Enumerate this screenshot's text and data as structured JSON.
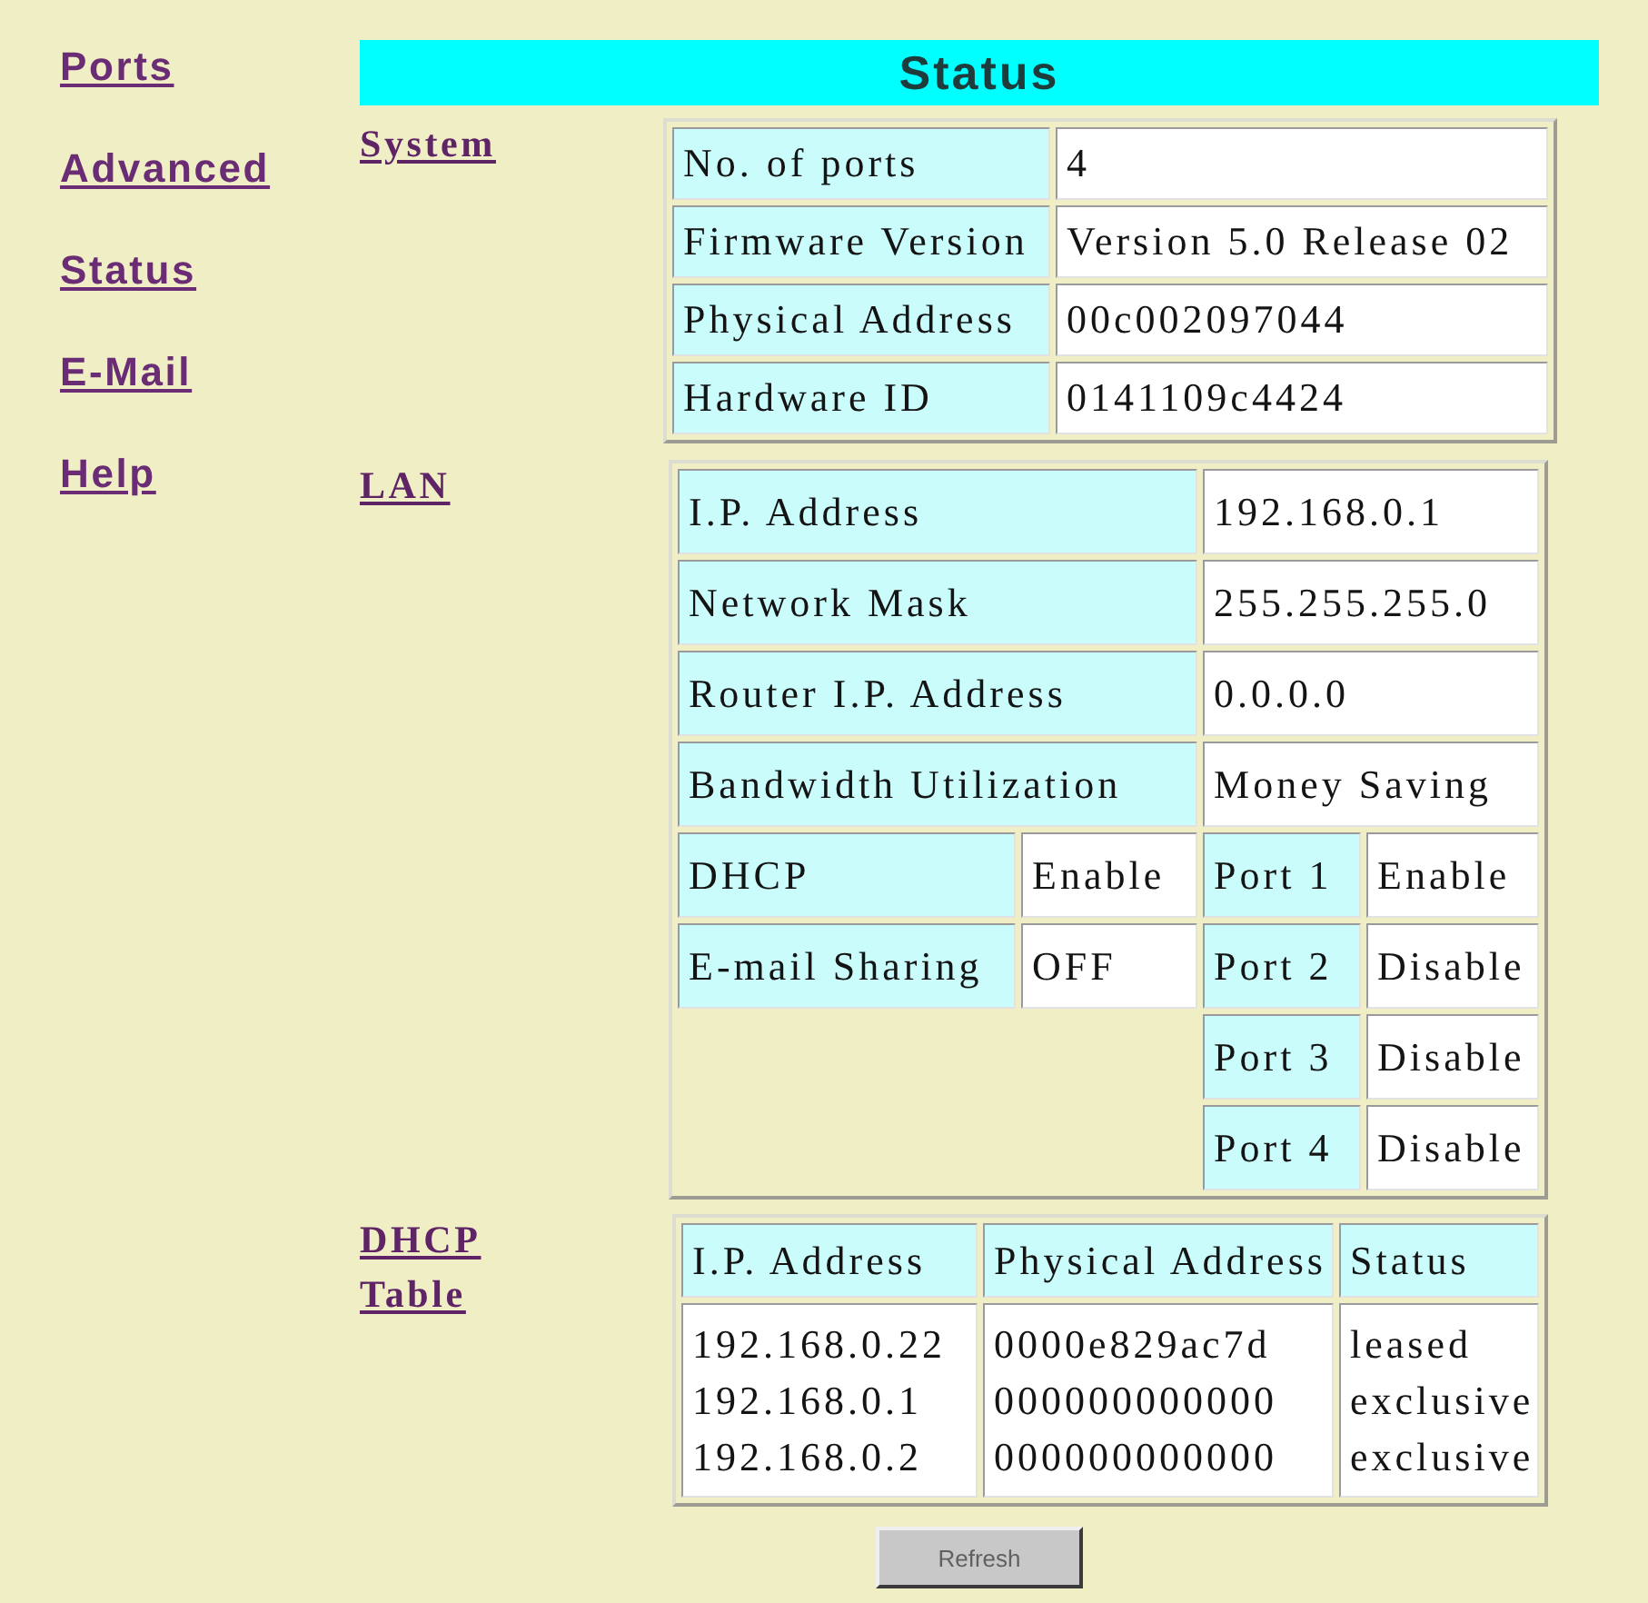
{
  "nav": [
    "Ports",
    "Advanced",
    "Status",
    "E-Mail",
    "Help"
  ],
  "title": "Status",
  "system": {
    "heading": "System",
    "rows": [
      {
        "label": "No. of ports",
        "value": "4"
      },
      {
        "label": "Firmware Version",
        "value": "Version 5.0 Release 02"
      },
      {
        "label": "Physical Address",
        "value": "00c002097044"
      },
      {
        "label": "Hardware ID",
        "value": "0141109c4424"
      }
    ]
  },
  "lan": {
    "heading": "LAN",
    "rows": [
      {
        "label": "I.P. Address",
        "value": "192.168.0.1"
      },
      {
        "label": "Network Mask",
        "value": "255.255.255.0"
      },
      {
        "label": "Router I.P. Address",
        "value": "0.0.0.0"
      },
      {
        "label": "Bandwidth Utilization",
        "value": "Money Saving"
      }
    ],
    "settings": [
      {
        "label": "DHCP",
        "value": "Enable"
      },
      {
        "label": "E-mail Sharing",
        "value": "OFF"
      }
    ],
    "ports": [
      {
        "label": "Port 1",
        "value": "Enable"
      },
      {
        "label": "Port 2",
        "value": "Disable"
      },
      {
        "label": "Port 3",
        "value": "Disable"
      },
      {
        "label": "Port 4",
        "value": "Disable"
      }
    ]
  },
  "dhcp_table": {
    "heading": "DHCP Table",
    "columns": [
      "I.P. Address",
      "Physical Address",
      "Status"
    ],
    "rows": [
      {
        "ip_address": "192.168.0.22",
        "physical_address": "0000e829ac7d",
        "status": "leased"
      },
      {
        "ip_address": "192.168.0.1",
        "physical_address": "000000000000",
        "status": "exclusive"
      },
      {
        "ip_address": "192.168.0.2",
        "physical_address": "000000000000",
        "status": "exclusive"
      }
    ]
  },
  "refresh_button": "Refresh"
}
